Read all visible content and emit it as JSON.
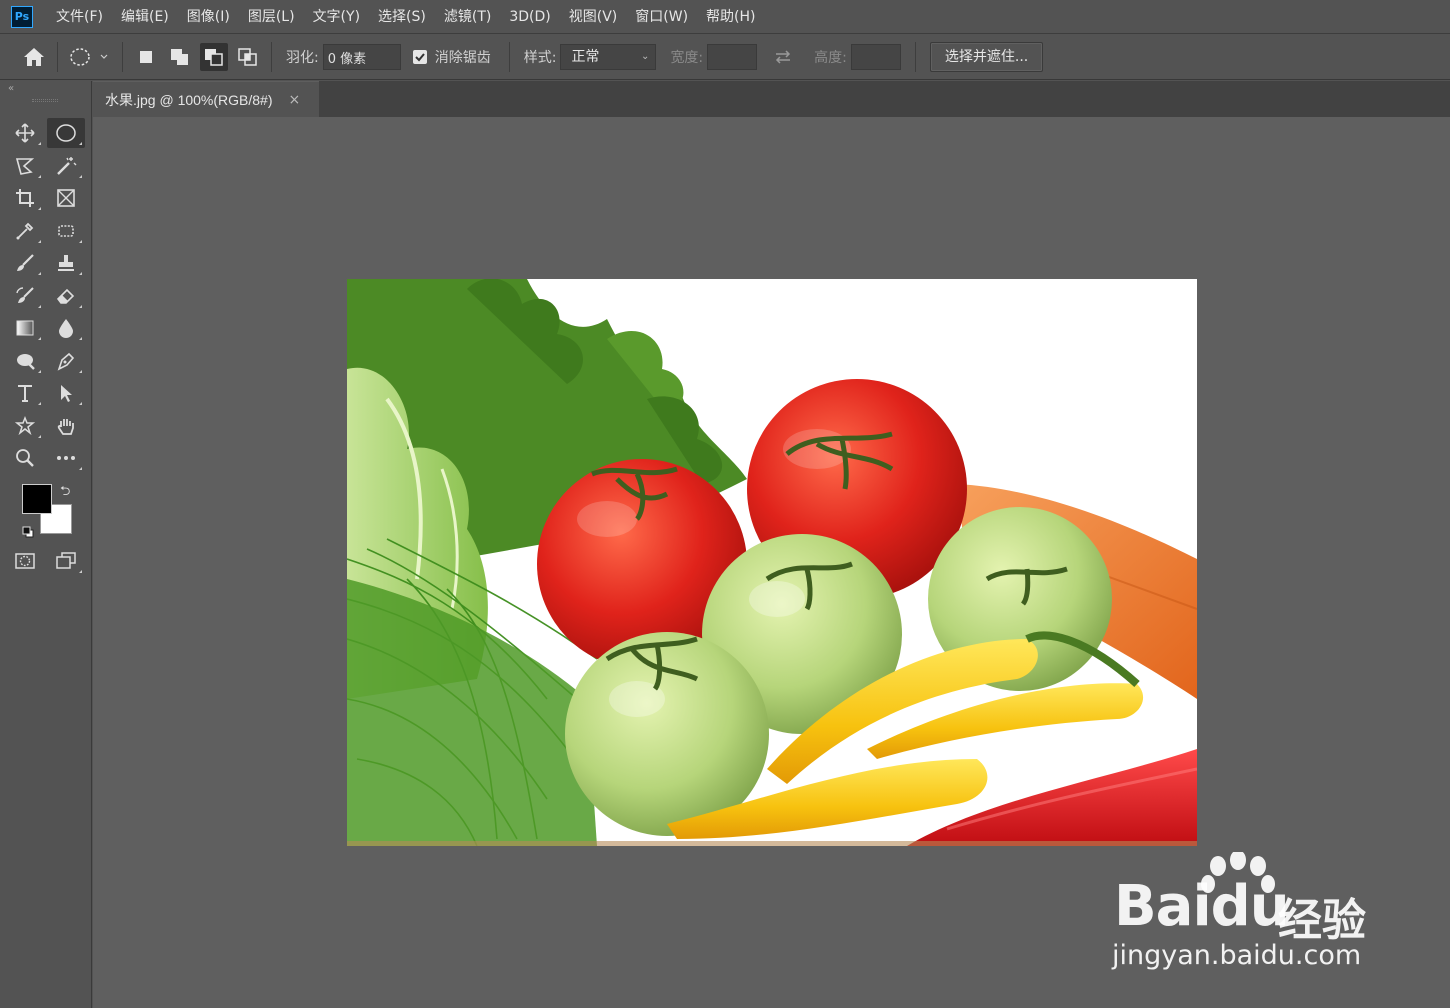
{
  "app": {
    "logo": "Ps",
    "menu": [
      "文件(F)",
      "编辑(E)",
      "图像(I)",
      "图层(L)",
      "文字(Y)",
      "选择(S)",
      "滤镜(T)",
      "3D(D)",
      "视图(V)",
      "窗口(W)",
      "帮助(H)"
    ]
  },
  "options": {
    "feather_label": "羽化:",
    "feather_value": "0 像素",
    "antialias_label": "消除锯齿",
    "antialias_checked": true,
    "style_label": "样式:",
    "style_value": "正常",
    "width_label": "宽度:",
    "height_label": "高度:",
    "select_mask_button": "选择并遮住..."
  },
  "document": {
    "tab_title": "水果.jpg @ 100%(RGB/8#)",
    "close_glyph": "×"
  },
  "colors": {
    "foreground": "#000000",
    "background": "#ffffff",
    "ui_background": "#535353",
    "canvas_background": "#5f5f5f"
  },
  "watermark": {
    "brand": "Bai",
    "brand_du": "du",
    "brand_cn": "经验",
    "url": "jingyan.baidu.com"
  }
}
